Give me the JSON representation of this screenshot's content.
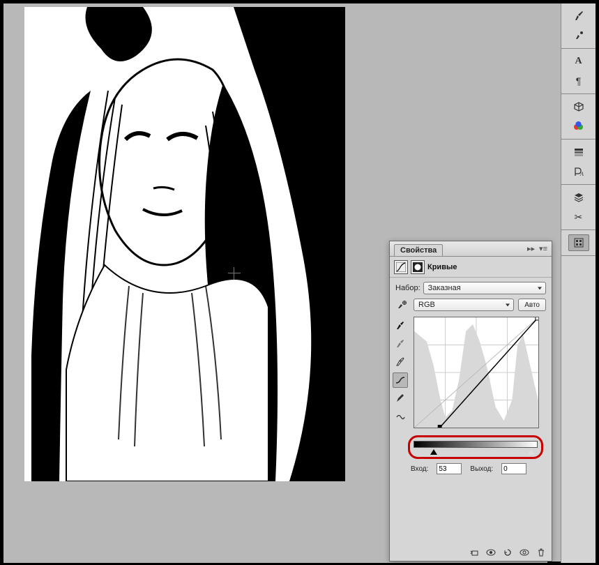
{
  "panel": {
    "tab_title": "Свойства",
    "adjustment_name": "Кривые",
    "preset_label": "Набор:",
    "preset_value": "Заказная",
    "channel_value": "RGB",
    "auto_label": "Авто",
    "input_label": "Вход:",
    "input_value": "53",
    "output_label": "Выход:",
    "output_value": "0"
  },
  "right_dock": {
    "groups": [
      [
        "brushes-icon",
        "brush-presets-icon"
      ],
      [
        "character-icon",
        "paragraph-icon"
      ],
      [
        "3d-icon",
        "materials-icon"
      ],
      [
        "channels-icon",
        "paths-icon"
      ],
      [
        "layers-icon",
        "adjustments-icon"
      ],
      [
        "properties-icon"
      ]
    ]
  }
}
